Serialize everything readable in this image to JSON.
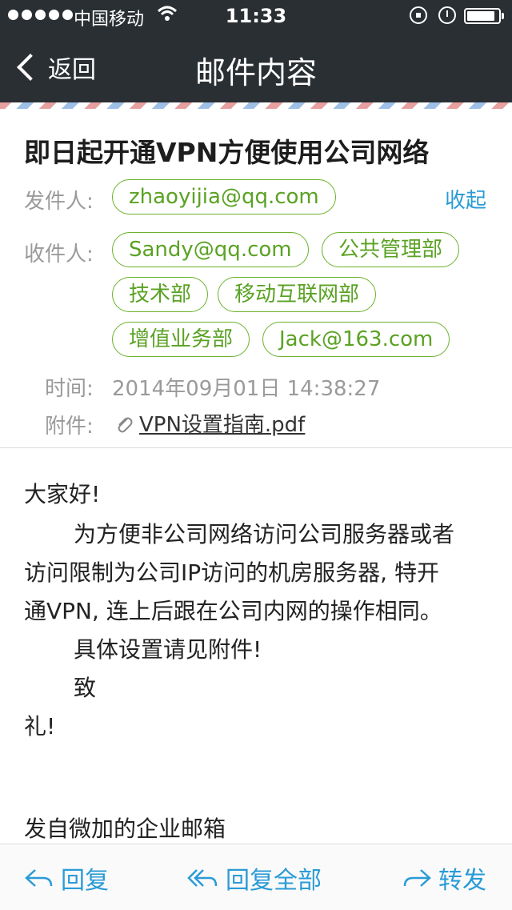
{
  "status_bar": {
    "carrier": "中国移动",
    "time": "11:33",
    "battery_level": 0.9
  },
  "nav": {
    "back_label": "返回",
    "title": "邮件内容"
  },
  "mail": {
    "subject": "即日起开通VPN方便使用公司网络",
    "sender_label": "发件人:",
    "sender": "zhaoyijia@qq.com",
    "collapse_label": "收起",
    "recipients_label": "收件人:",
    "recipients": [
      "Sandy@qq.com",
      "公共管理部",
      "技术部",
      "移动互联网部",
      "增值业务部",
      "Jack@163.com"
    ],
    "time_label": "时间:",
    "time": "2014年09月01日 14:38:27",
    "attachment_label": "附件:",
    "attachment": "VPN设置指南.pdf"
  },
  "body": {
    "lines": [
      "大家好!",
      "为方便非公司网络访问公司服务器或者",
      "访问限制为公司IP访问的机房服务器, 特开",
      "通VPN, 连上后跟在公司内网的操作相同。",
      "具体设置请见附件!",
      "致",
      "礼!",
      "发自微加的企业邮箱"
    ]
  },
  "toolbar": {
    "reply": "回复",
    "reply_all": "回复全部",
    "forward": "转发"
  },
  "colors": {
    "accent": "#2a9bd6",
    "chip": "#5aa223",
    "topbar": "#2a2f33"
  }
}
